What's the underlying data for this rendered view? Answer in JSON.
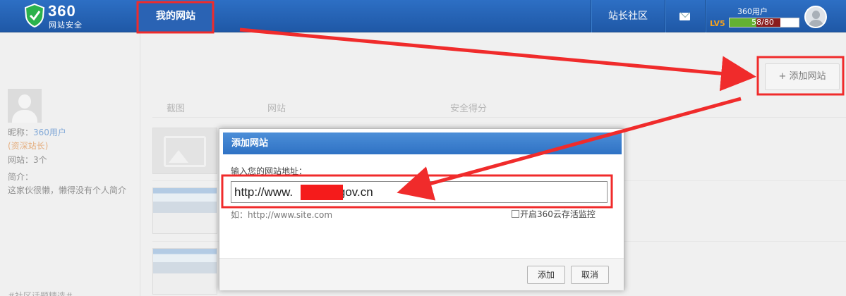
{
  "header": {
    "logo_number": "360",
    "logo_subtitle": "网站安全",
    "nav_mysite": "我的网站",
    "nav_community": "站长社区",
    "user_name": "360用户",
    "level": "LV5",
    "level_progress": "58/80"
  },
  "sidebar": {
    "nickname_label": "昵称：",
    "nickname_value": "360用户",
    "rank": "(资深站长)",
    "sites": "网站：3个",
    "bio_label": "简介：",
    "bio_text": "这家伙很懒，懒得没有个人简介",
    "footer_note": "#社区话题精选#"
  },
  "main": {
    "add_site_button": "+ 添加网站",
    "columns": [
      "截图",
      "网站",
      "安全得分"
    ]
  },
  "dialog": {
    "title": "添加网站",
    "input_label": "输入您的网站地址：",
    "input_value_prefix": "http://www.",
    "input_value_suffix": ".gov.cn",
    "example_hint": "如：http://www.site.com",
    "monitor_label": "开启360云存活监控",
    "add_button": "添加",
    "cancel_button": "取消"
  },
  "colors": {
    "header_blue": "#2a63b4",
    "annotation_red": "#f02b2b",
    "level_orange": "#f7a21b",
    "level_green": "#63b133"
  }
}
